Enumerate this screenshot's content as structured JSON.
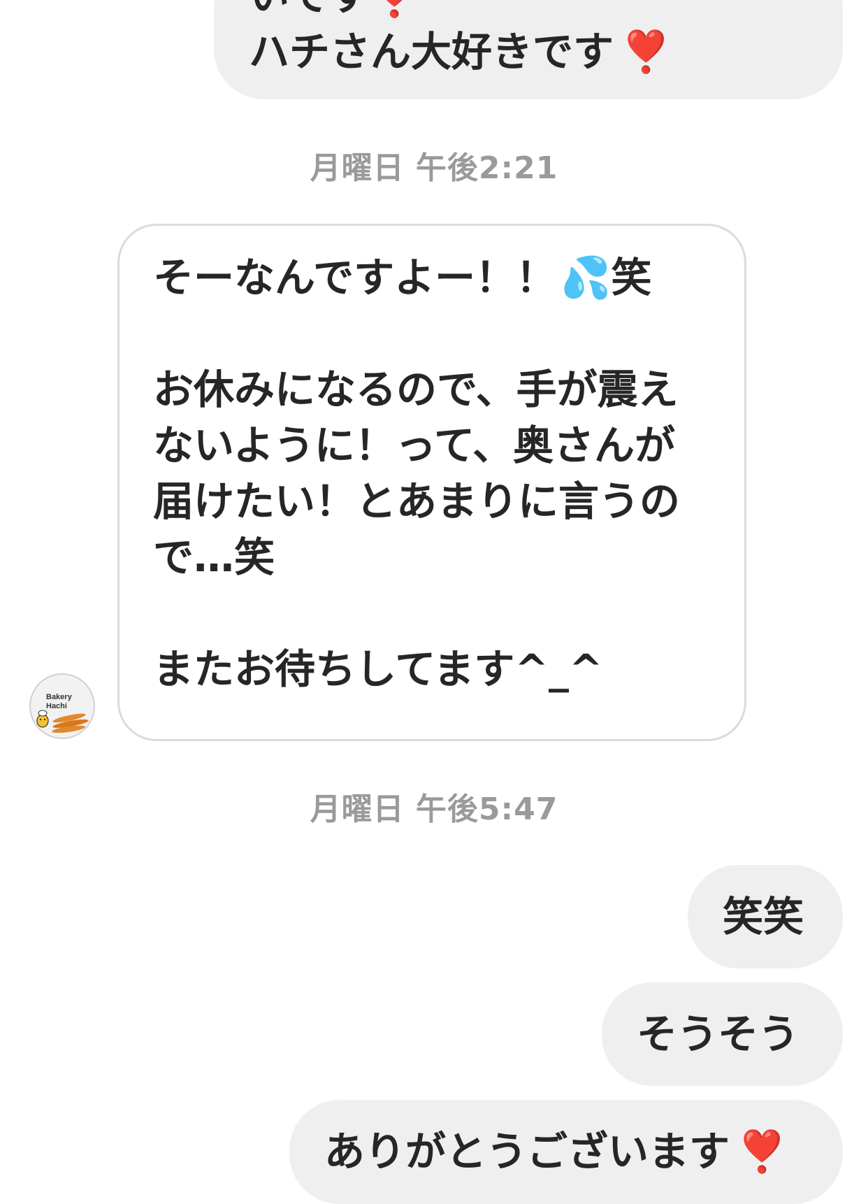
{
  "messages": {
    "top_outgoing": {
      "partial_line": "いです❣️",
      "line": "ハチさん大好きです",
      "heart": "❣️"
    },
    "timestamp_1": "月曜日 午後2:21",
    "incoming": {
      "line1_text": "そーなんですよー！！",
      "line1_emoji": "💦",
      "line1_tail": "笑",
      "line3": "お休みになるので、手が震え",
      "line4": "ないように！って、奥さんが",
      "line5": "届けたい！とあまりに言うの",
      "line6": "で…笑",
      "line8": "またお待ちしてます^_^"
    },
    "avatar": {
      "line1": "Bakery",
      "line2": "Hachi"
    },
    "timestamp_2": "月曜日 午後5:47",
    "outgoing_1": "笑笑",
    "outgoing_2": "そうそう",
    "outgoing_3": {
      "text": "ありがとうございます",
      "heart": "❣️"
    }
  },
  "colors": {
    "outgoing_bubble": "#efefef",
    "incoming_border": "#dbdbdb",
    "timestamp": "#9a9a9a",
    "heart": "#e0112b"
  }
}
